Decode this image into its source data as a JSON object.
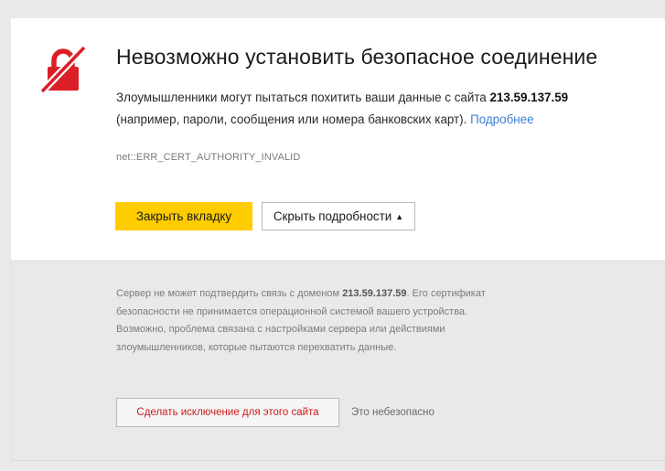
{
  "page": {
    "title": "Невозможно установить безопасное соединение",
    "description_before": "Злоумышленники могут пытаться похитить ваши данные с сайта ",
    "host": "213.59.137.59",
    "description_after": "(например, пароли, сообщения или номера банковских карт). ",
    "more_link": "Подробнее",
    "error_code": "net::ERR_CERT_AUTHORITY_INVALID"
  },
  "actions": {
    "close_tab": "Закрыть вкладку",
    "hide_details": "Скрыть подробности",
    "hide_details_arrow": "▲"
  },
  "details": {
    "server_text_before": "Сервер не может подтвердить связь с доменом ",
    "host": "213.59.137.59",
    "server_text_after": ". Его сертификат безопасности не принимается операционной системой вашего устройства. Возможно, проблема связана с настройками сервера или действиями злоумышленников, которые пытаются перехватить данные.",
    "exception_button": "Сделать исключение для этого сайта",
    "unsafe_note": "Это небезопасно"
  },
  "colors": {
    "lock_icon": "#dc1f26",
    "primary_button": "#ffcc00",
    "link": "#3a7fd1",
    "exception_text": "#cc1b1b"
  },
  "icons": {
    "lock": "broken-lock-icon"
  }
}
